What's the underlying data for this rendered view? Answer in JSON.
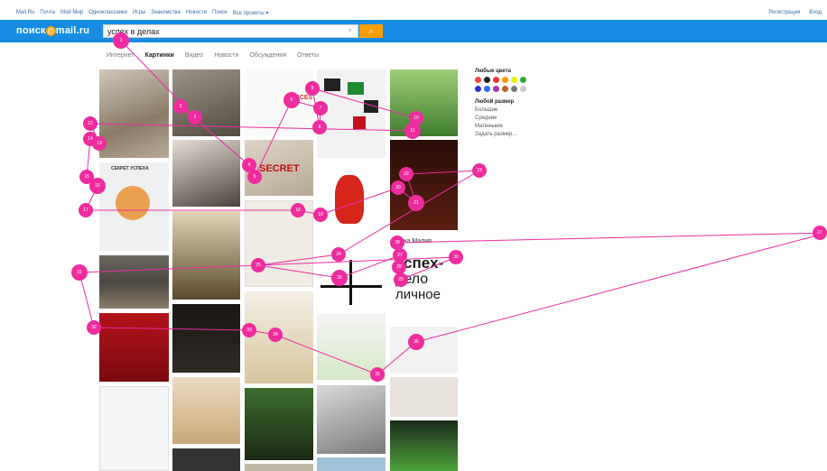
{
  "topbar": {
    "links": [
      "Mail.Ru",
      "Почта",
      "Мой Мир",
      "Одноклассники",
      "Игры",
      "Знакомства",
      "Новости",
      "Поиск",
      "Все проекты ▾"
    ],
    "register": "Регистрация",
    "login": "Вход"
  },
  "search": {
    "logo_left": "поиск",
    "logo_at": "@",
    "logo_right": "mail.ru",
    "query": "успех в делах",
    "clear_glyph": "×",
    "button_glyph": "⌕"
  },
  "tabs": [
    "Интернет",
    "Картинки",
    "Видео",
    "Новости",
    "Обсуждения",
    "Ответы"
  ],
  "filters": {
    "color_title": "Любые цвета",
    "colors": [
      "#e44",
      "#222",
      "#e33",
      "#f90",
      "#ee0",
      "#3a3",
      "#33c",
      "#36f",
      "#a3a",
      "#b62",
      "#777",
      "#ccc"
    ],
    "size_title": "Любой размер",
    "sizes": [
      "Большие",
      "Средние",
      "Маленькие",
      "Задать размер..."
    ]
  },
  "image_texts": {
    "secret_book": "СЕКРЕТ УСПЕХА",
    "secret_stamp": "SECRET",
    "uspekh_1": "успех-",
    "uspekh_2": "дело",
    "uspekh_3": "личное",
    "author": "Елена Малия",
    "success_banner": "SUCCES"
  },
  "gaze_labels": [
    "1",
    "2",
    "3",
    "4",
    "5",
    "6",
    "7",
    "8",
    "9",
    "10",
    "11",
    "12",
    "13",
    "14",
    "15",
    "16",
    "17",
    "18",
    "19",
    "20",
    "21",
    "22",
    "23",
    "24",
    "25",
    "26",
    "27",
    "28",
    "29",
    "30",
    "31",
    "32",
    "33",
    "34",
    "35",
    "36",
    "37",
    "38"
  ],
  "colors": {
    "accent": "#168de2",
    "search_button": "#ff9e00",
    "gaze": "#ee2c9e"
  }
}
